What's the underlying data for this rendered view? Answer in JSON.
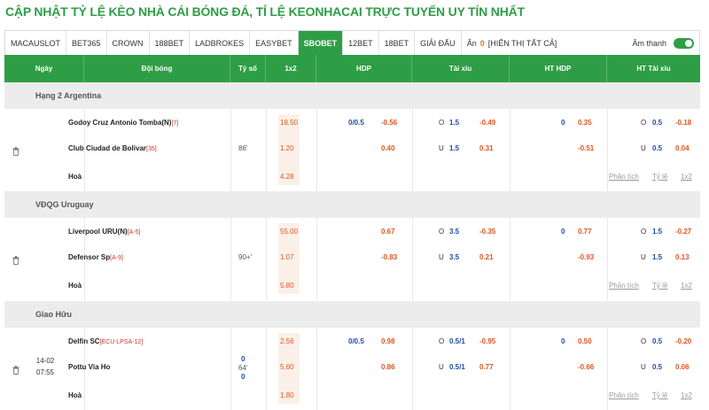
{
  "page": {
    "title": "CẬP NHẬT TỶ LỆ KÈO NHÀ CÁI BÓNG ĐÁ, TỈ LỆ KEONHACAI TRỰC TUYẾN UY TÍN NHẤT"
  },
  "tabs": [
    "MACAUSLOT",
    "BET365",
    "CROWN",
    "188BET",
    "LADBROKES",
    "EASYBET",
    "SBOBET",
    "12BET",
    "18BET",
    "GIẢI ĐẤU"
  ],
  "active_tab": "SBOBET",
  "hide": {
    "label": "Ẩn",
    "count": "0",
    "show_all": "[HIỂN THỊ TẤT CẢ]"
  },
  "sound": {
    "label": "Âm thanh",
    "on": true
  },
  "columns": {
    "date": "Ngày",
    "teams": "Đội bóng",
    "score": "Tỷ số",
    "x12": "1x2",
    "hdp": "HDP",
    "tx": "Tài xỉu",
    "hthdp": "HT HDP",
    "httx": "HT Tài xỉu"
  },
  "links": {
    "analysis": "Phân tích",
    "odds": "Tỷ lệ",
    "x12": "1x2"
  },
  "leagues": [
    {
      "name": "Hạng 2 Argentina",
      "match": {
        "date": "",
        "time": "",
        "home": {
          "name": "Godoy Cruz Antonio Tomba(N)",
          "rank": "[7]"
        },
        "away": {
          "name": "Club Ciudad de Bolivar",
          "rank": "[35]"
        },
        "draw": "Hoà",
        "score": "86'",
        "score_extra": "",
        "x12": [
          "18.50",
          "1.20",
          "4.28"
        ],
        "hdp": {
          "line": "0/0.5",
          "home": "-0.56",
          "away": "0.40"
        },
        "tx": {
          "o": "O",
          "line_o": "1.5",
          "over": "-0.49",
          "u": "U",
          "line_u": "1.5",
          "under": "0.31"
        },
        "hthdp": {
          "line": "0",
          "home": "0.35",
          "away": "-0.51"
        },
        "httx": {
          "o": "O",
          "line_o": "0.5",
          "over": "-0.18",
          "u": "U",
          "line_u": "0.5",
          "under": "0.04"
        }
      }
    },
    {
      "name": "VĐQG Uruguay",
      "match": {
        "date": "",
        "time": "",
        "home": {
          "name": "Liverpool URU(N)",
          "rank": "[A-5]"
        },
        "away": {
          "name": "Defensor Sp",
          "rank": "[A-9]"
        },
        "draw": "Hoà",
        "score": "90+'",
        "score_extra": "",
        "x12": [
          "55.00",
          "1.07",
          "5.80"
        ],
        "hdp": {
          "line": "",
          "home": "0.67",
          "away": "-0.83"
        },
        "tx": {
          "o": "O",
          "line_o": "3.5",
          "over": "-0.35",
          "u": "U",
          "line_u": "3.5",
          "under": "0.21"
        },
        "hthdp": {
          "line": "0",
          "home": "0.77",
          "away": "-0.93"
        },
        "httx": {
          "o": "O",
          "line_o": "1.5",
          "over": "-0.27",
          "u": "U",
          "line_u": "1.5",
          "under": "0.13"
        }
      }
    },
    {
      "name": "Giao Hữu",
      "match": {
        "date": "14-02",
        "time": "07:55",
        "home": {
          "name": "Delfin SC",
          "rank": "[ECU LPSA-12]"
        },
        "away": {
          "name": "Pottu Via Ho",
          "rank": ""
        },
        "draw": "Hoà",
        "score": "64'",
        "score_top": "0",
        "score_bottom": "0",
        "x12": [
          "2.56",
          "5.60",
          "1.80"
        ],
        "hdp": {
          "line": "0/0.5",
          "home": "0.98",
          "away": "0.86"
        },
        "tx": {
          "o": "O",
          "line_o": "0.5/1",
          "over": "-0.95",
          "u": "U",
          "line_u": "0.5/1",
          "under": "0.77"
        },
        "hthdp": {
          "line": "0",
          "home": "0.50",
          "away": "-0.66"
        },
        "httx": {
          "o": "O",
          "line_o": "0.5",
          "over": "-0.20",
          "u": "U",
          "line_u": "0.5",
          "under": "0.06"
        }
      }
    }
  ]
}
